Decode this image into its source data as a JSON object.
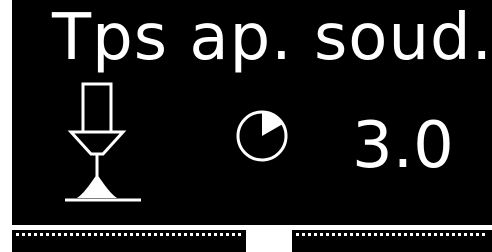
{
  "screen": {
    "title": "Tps ap. soud.",
    "value": "3.0",
    "icons": {
      "process": "welding-torch-icon",
      "parameter": "timer-icon"
    },
    "softkeys": [
      "",
      ""
    ]
  }
}
